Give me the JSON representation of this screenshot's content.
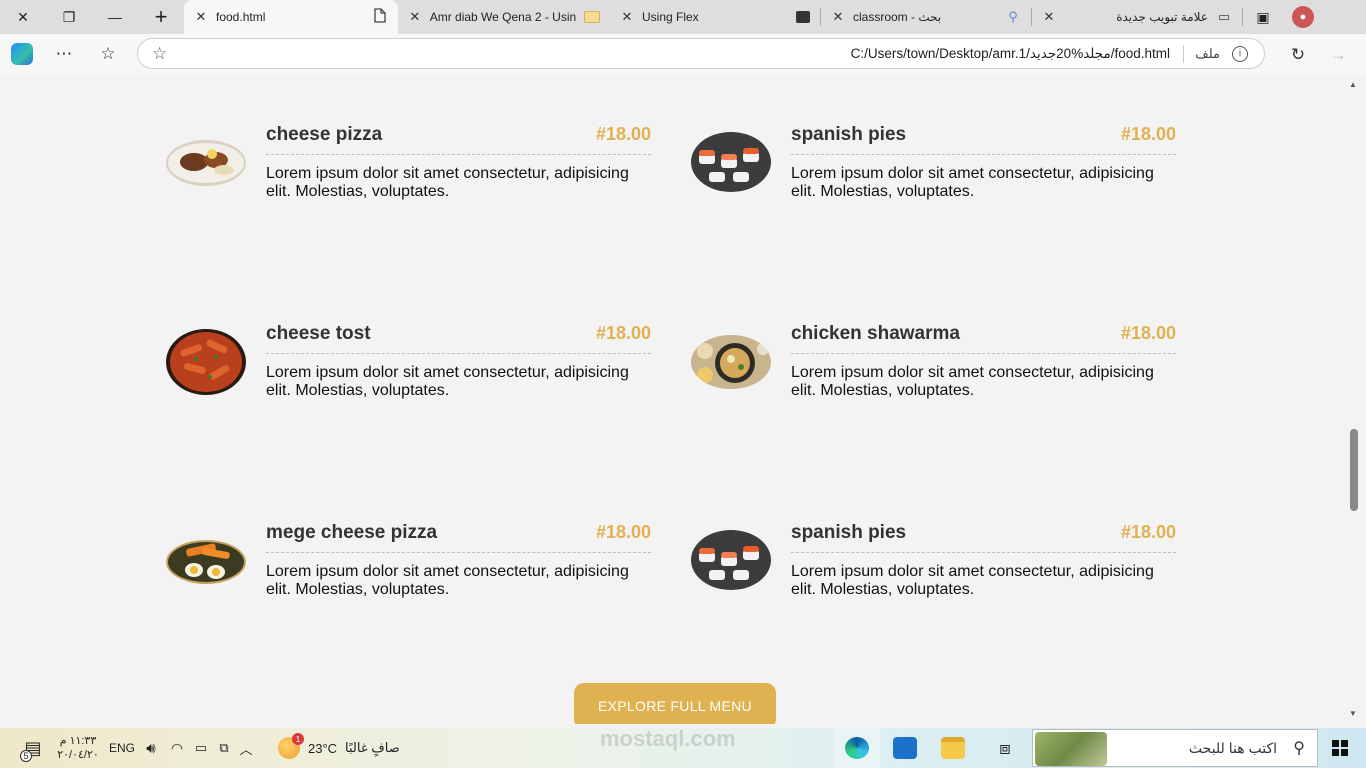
{
  "window_controls": {
    "close": "✕",
    "restore": "❐",
    "minimize": "—",
    "new_tab": "+"
  },
  "tabs": [
    {
      "title": "food.html",
      "active": true,
      "icon": "document-icon"
    },
    {
      "title": "Amr diab We Qena 2 - Using",
      "active": false,
      "icon": "folder-icon"
    },
    {
      "title": "Using Flex",
      "active": false,
      "icon": "profile-card-icon"
    },
    {
      "title": "classroom - بحث",
      "active": false,
      "icon": "search-icon"
    },
    {
      "title": "علامة تبويب جديدة",
      "active": false,
      "icon": "new-tab-icon"
    }
  ],
  "address_bar": {
    "url": "C:/Users/town/Desktop/amr.1/مجلد%20جديد/food.html",
    "scheme_label": "ملف"
  },
  "menu": {
    "items": [
      {
        "name": "cheese pizza",
        "price": "#18.00",
        "description": "Lorem ipsum dolor sit amet consectetur, adipisicing elit. Molestias, voluptates.",
        "image": "plate-meat-rice"
      },
      {
        "name": "spanish pies",
        "price": "#18.00",
        "description": "Lorem ipsum dolor sit amet consectetur, adipisicing elit. Molestias, voluptates.",
        "image": "sushi-platter"
      },
      {
        "name": "cheese tost",
        "price": "#18.00",
        "description": "Lorem ipsum dolor sit amet consectetur, adipisicing elit. Molestias, voluptates.",
        "image": "penne-pasta"
      },
      {
        "name": "chicken shawarma",
        "price": "#18.00",
        "description": "Lorem ipsum dolor sit amet consectetur, adipisicing elit. Molestias, voluptates.",
        "image": "ramen-bowl"
      },
      {
        "name": "mege cheese pizza",
        "price": "#18.00",
        "description": "Lorem ipsum dolor sit amet consectetur, adipisicing elit. Molestias, voluptates.",
        "image": "egg-bowl"
      },
      {
        "name": "spanish pies",
        "price": "#18.00",
        "description": "Lorem ipsum dolor sit amet consectetur, adipisicing elit. Molestias, voluptates.",
        "image": "sushi-platter"
      }
    ],
    "explore_button": "EXPLORE FULL MENU"
  },
  "watermark": "mostaql.com",
  "taskbar": {
    "time": "١١:٣٣ م",
    "date": "٢٠/٠٤/٢٠",
    "language": "ENG",
    "notification_count": "5",
    "weather_temp": "23°C",
    "weather_desc": "صافٍ غالبًا",
    "weather_badge": "1",
    "search_placeholder": "اكتب هنا للبحث"
  },
  "colors": {
    "accent": "#e0b150",
    "text": "#333333",
    "background": "#f3f3f3"
  }
}
